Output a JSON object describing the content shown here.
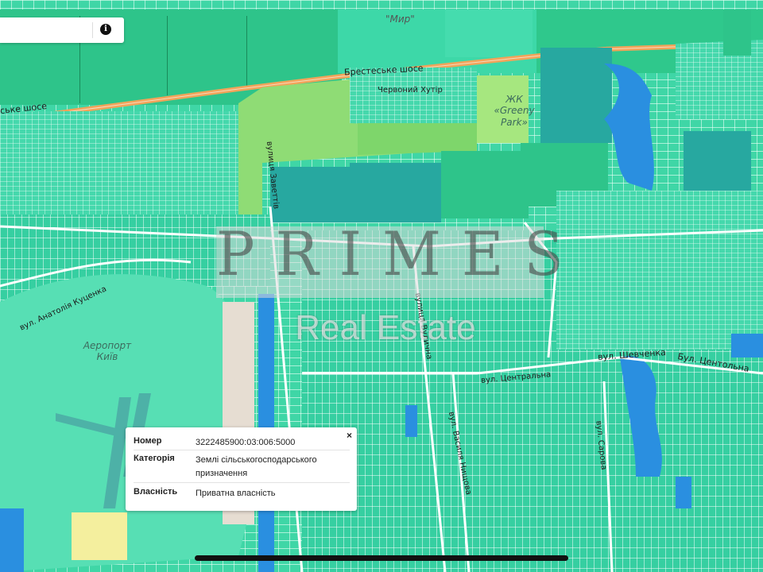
{
  "map": {
    "labels": {
      "myr": "\"Мир\"",
      "brest_highway": "Брестеське шосе",
      "brest_highway_left": "ськe шосе",
      "chervonyi_khutir": "Червоний Хутір",
      "greeny_park": "ЖК «Greeny Park»",
      "zaviettiv_street": "вулиця Заветтів",
      "anatoliia_kutsenka_street": "вул. Анатолія Куценка",
      "airport": "Аеропорт Київ",
      "vulychna_street": "вулиця Вулична",
      "tsentralna_street": "вул. Центральна",
      "shevchenka_street": "вул. Шевченка",
      "tsentolna_street": "Бул. Центольна",
      "vasylia_nishchova_street": "вул. Василя Нищова",
      "sarova_street": "вул. Сарова"
    },
    "colors": {
      "base_parcel": "#3fd6a6",
      "agricultural": "#2ec48a",
      "dark_parcel": "#27a8a0",
      "water": "#2a8fe0",
      "highway": "#f2a45a",
      "roads": "#ffffff",
      "light_green": "#8fdc75"
    }
  },
  "search": {
    "info_icon": "info-icon"
  },
  "watermark": {
    "title": "PRIMES",
    "subtitle": "Real Estate"
  },
  "popup": {
    "close_label": "×",
    "rows": [
      {
        "key": "Номер",
        "value": "3222485900:03:006:5000"
      },
      {
        "key": "Категорія",
        "value": "Землі сільськогосподарського призначення"
      },
      {
        "key": "Власність",
        "value": "Приватна власність"
      }
    ]
  }
}
